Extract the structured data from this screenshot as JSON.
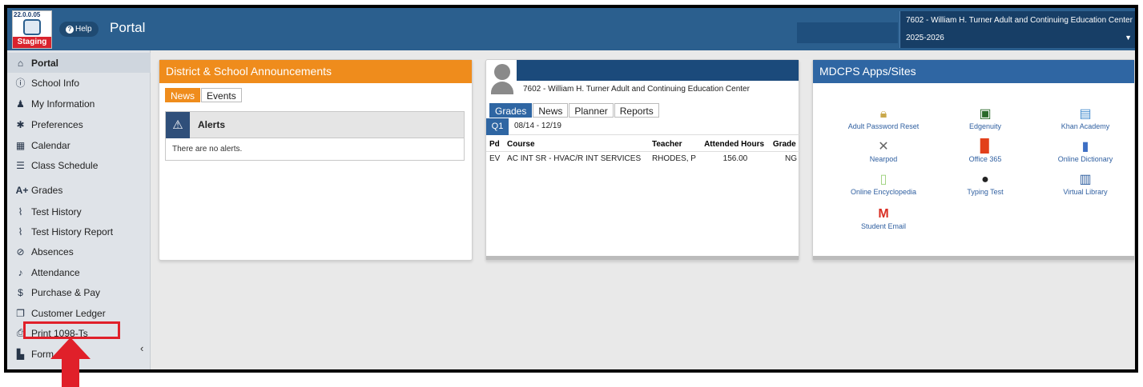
{
  "header": {
    "logo_version": "22.0.0.05",
    "logo_badge": "Staging",
    "help_label": "Help",
    "app_title": "Portal",
    "school_name": "7602 - William H. Turner Adult and Continuing Education Center",
    "school_year": "2025-2026"
  },
  "sidebar": {
    "items": [
      {
        "label": "Portal",
        "icon": "home-icon"
      },
      {
        "label": "School Info",
        "icon": "info-icon"
      },
      {
        "label": "My Information",
        "icon": "user-icon"
      },
      {
        "label": "Preferences",
        "icon": "gear-icon"
      },
      {
        "label": "Calendar",
        "icon": "calendar-icon"
      },
      {
        "label": "Class Schedule",
        "icon": "list-icon"
      },
      {
        "label": "Grades",
        "icon": "grades-icon"
      },
      {
        "label": "Test History",
        "icon": "chart-line-icon"
      },
      {
        "label": "Test History Report",
        "icon": "chart-line-icon"
      },
      {
        "label": "Absences",
        "icon": "ban-icon"
      },
      {
        "label": "Attendance",
        "icon": "bell-icon"
      },
      {
        "label": "Purchase & Pay",
        "icon": "dollar-icon"
      },
      {
        "label": "Customer Ledger",
        "icon": "copy-icon"
      },
      {
        "label": "Print 1098-Ts",
        "icon": "print-icon"
      },
      {
        "label": "Form",
        "icon": "document-icon"
      }
    ]
  },
  "announcements": {
    "title": "District & School Announcements",
    "tabs": [
      "News",
      "Events"
    ],
    "alerts_title": "Alerts",
    "alerts_empty": "There are no alerts."
  },
  "student": {
    "school": "7602 - William H. Turner Adult and Continuing Education Center",
    "tabs": [
      "Grades",
      "News",
      "Planner",
      "Reports"
    ],
    "term": "Q1",
    "term_range": "08/14 - 12/19",
    "columns": [
      "Pd",
      "Course",
      "Teacher",
      "Attended Hours",
      "Grade"
    ],
    "rows": [
      {
        "pd": "EV",
        "course": "AC INT SR - HVAC/R INT SERVICES",
        "teacher": "RHODES, P",
        "hours": "156.00",
        "grade": "NG"
      }
    ]
  },
  "apps": {
    "title": "MDCPS Apps/Sites",
    "items": [
      {
        "label": "Adult Password Reset",
        "icon": "lock-icon"
      },
      {
        "label": "Edgenuity",
        "icon": "monitor-icon"
      },
      {
        "label": "Khan Academy",
        "icon": "computer-icon"
      },
      {
        "label": "Nearpod",
        "icon": "tools-icon"
      },
      {
        "label": "Office 365",
        "icon": "office-icon"
      },
      {
        "label": "Online Dictionary",
        "icon": "book-icon"
      },
      {
        "label": "Online Encyclopedia",
        "icon": "notebook-icon"
      },
      {
        "label": "Typing Test",
        "icon": "keyboard-icon"
      },
      {
        "label": "Virtual Library",
        "icon": "library-icon"
      },
      {
        "label": "Student Email",
        "icon": "gmail-icon"
      }
    ]
  },
  "colors": {
    "header": "#2b5f8e",
    "orange": "#ef8c1c",
    "blue": "#2f66a3",
    "annotation": "#e0202a"
  }
}
